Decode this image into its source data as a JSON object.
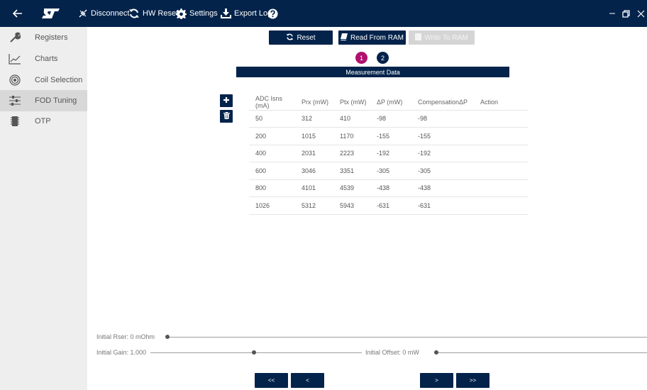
{
  "titlebar": {
    "disconnect_label": "Disconnect",
    "hw_reset_label": "HW Reset",
    "settings_label": "Settings",
    "export_log_label": "Export Log",
    "logo_text": "ST",
    "background_color": "#03234b"
  },
  "sidebar": {
    "items": [
      {
        "label": "Registers",
        "icon": "wrench-icon"
      },
      {
        "label": "Charts",
        "icon": "line-chart-icon"
      },
      {
        "label": "Coil Selection",
        "icon": "coil-icon"
      },
      {
        "label": "FOD Tuning",
        "icon": "sliders-icon",
        "active": true
      },
      {
        "label": "OTP",
        "icon": "chip-icon"
      }
    ]
  },
  "toolbar": {
    "reset_label": "Reset",
    "read_label": "Read From RAM",
    "write_label": "Write To RAM",
    "write_disabled": true
  },
  "steps": [
    {
      "label": "1",
      "active": true,
      "color": "#b0106e"
    },
    {
      "label": "2",
      "active": false,
      "color": "#03234b"
    }
  ],
  "section_title": "Measurement Data",
  "table": {
    "headers": [
      "ADC Isns (mA)",
      "Prx (mW)",
      "Ptx (mW)",
      "ΔP (mW)",
      "CompensationΔP",
      "Action"
    ],
    "rows": [
      [
        "50",
        "312",
        "410",
        "-98",
        "-98",
        ""
      ],
      [
        "200",
        "1015",
        "1170",
        "-155",
        "-155",
        ""
      ],
      [
        "400",
        "2031",
        "2223",
        "-192",
        "-192",
        ""
      ],
      [
        "600",
        "3046",
        "3351",
        "-305",
        "-305",
        ""
      ],
      [
        "800",
        "4101",
        "4539",
        "-438",
        "-438",
        ""
      ],
      [
        "1026",
        "5312",
        "5943",
        "-631",
        "-631",
        ""
      ]
    ]
  },
  "sliders": {
    "rser_label": "Initial Rser: 0 mOhm",
    "gain_label": "Initial Gain: 1.000",
    "offset_label": "Initial Offset: 0 mW"
  },
  "pagination": {
    "first_label": "<<",
    "prev_label": "<",
    "next_label": ">",
    "last_label": ">>"
  }
}
